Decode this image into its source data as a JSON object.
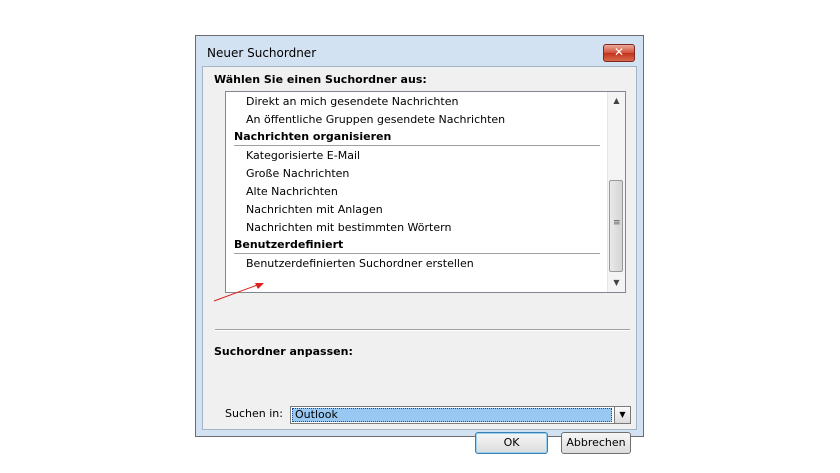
{
  "dialog": {
    "title": "Neuer Suchordner",
    "close_label": "✕",
    "choose_label": "Wählen Sie einen Suchordner aus:",
    "customize_label": "Suchordner anpassen:",
    "search_in_label": "Suchen in:",
    "search_in_value": "Outlook",
    "ok_label": "OK",
    "cancel_label": "Abbrechen"
  },
  "list": {
    "items": [
      {
        "type": "item",
        "label": "Direkt an mich gesendete Nachrichten"
      },
      {
        "type": "item",
        "label": "An öffentliche Gruppen gesendete Nachrichten"
      },
      {
        "type": "group",
        "label": "Nachrichten organisieren"
      },
      {
        "type": "item",
        "label": "Kategorisierte E-Mail"
      },
      {
        "type": "item",
        "label": "Große Nachrichten"
      },
      {
        "type": "item",
        "label": "Alte Nachrichten"
      },
      {
        "type": "item",
        "label": "Nachrichten mit Anlagen"
      },
      {
        "type": "item",
        "label": "Nachrichten mit bestimmten Wörtern"
      },
      {
        "type": "group",
        "label": "Benutzerdefiniert"
      },
      {
        "type": "item",
        "label": "Benutzerdefinierten Suchordner erstellen"
      }
    ]
  },
  "annotation": {
    "color": "#e02020"
  }
}
